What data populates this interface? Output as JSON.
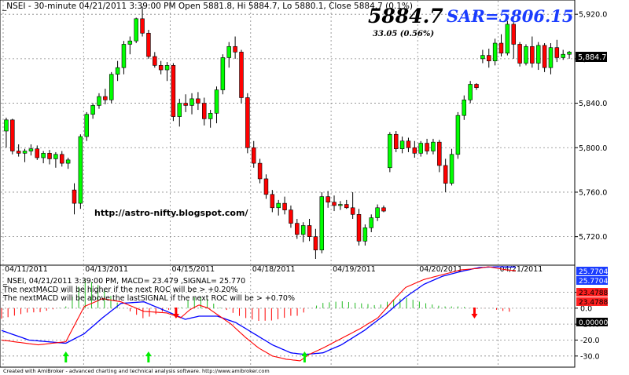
{
  "chart_data": [
    {
      "type": "candlestick",
      "header": "_NSEI - 30-minute 04/21/2011 3:39:00 PM Open 5881.8, Hi 5884.7, Lo 5880.1, Close 5884.7 (0.1%)",
      "big_price": "5884.7",
      "change_text": "33.05  (0.56%)",
      "sar_text": "SAR=5806.15",
      "watermark": "http://astro-nifty.blogspot.com/",
      "last_price_tag": "5,884.7",
      "ylim": [
        5700,
        5930
      ],
      "y_ticks": [
        5720,
        5760,
        5800,
        5840,
        5880,
        5920
      ],
      "y_tick_labels": [
        "5,720.0",
        "5,760.0",
        "5,800.0",
        "5,840.0",
        "5,880.0",
        "5,920.0"
      ],
      "x_ticks": [
        {
          "label": "04/11/2011",
          "bar": 0
        },
        {
          "label": "04/13/2011",
          "bar": 13
        },
        {
          "label": "04/15/2011",
          "bar": 27
        },
        {
          "label": "04/18/2011",
          "bar": 40
        },
        {
          "label": "04/19/2011",
          "bar": 53
        },
        {
          "label": "04/20/2011",
          "bar": 67
        },
        {
          "label": "04/21/2011",
          "bar": 80
        }
      ],
      "colors": {
        "up": "#00ff00",
        "down": "#ff0000"
      },
      "grid": true,
      "ohlc": [
        [
          5815,
          5827,
          5800,
          5825
        ],
        [
          5825,
          5826,
          5794,
          5797
        ],
        [
          5797,
          5803,
          5792,
          5795
        ],
        [
          5795,
          5799,
          5787,
          5797
        ],
        [
          5797,
          5803,
          5793,
          5799
        ],
        [
          5799,
          5802,
          5789,
          5791
        ],
        [
          5791,
          5797,
          5786,
          5795
        ],
        [
          5795,
          5798,
          5785,
          5790
        ],
        [
          5790,
          5796,
          5782,
          5794
        ],
        [
          5794,
          5797,
          5783,
          5786
        ],
        [
          5786,
          5791,
          5781,
          5789
        ],
        [
          5762,
          5768,
          5740,
          5750
        ],
        [
          5750,
          5812,
          5745,
          5810
        ],
        [
          5810,
          5832,
          5806,
          5830
        ],
        [
          5830,
          5840,
          5826,
          5838
        ],
        [
          5838,
          5849,
          5835,
          5846
        ],
        [
          5846,
          5853,
          5839,
          5843
        ],
        [
          5843,
          5868,
          5840,
          5866
        ],
        [
          5866,
          5878,
          5860,
          5872
        ],
        [
          5872,
          5896,
          5866,
          5893
        ],
        [
          5893,
          5900,
          5884,
          5896
        ],
        [
          5896,
          5917,
          5894,
          5916
        ],
        [
          5916,
          5927,
          5900,
          5903
        ],
        [
          5903,
          5906,
          5880,
          5882
        ],
        [
          5882,
          5886,
          5872,
          5874
        ],
        [
          5874,
          5878,
          5866,
          5870
        ],
        [
          5870,
          5877,
          5860,
          5874
        ],
        [
          5874,
          5876,
          5824,
          5828
        ],
        [
          5828,
          5844,
          5819,
          5840
        ],
        [
          5840,
          5848,
          5832,
          5838
        ],
        [
          5838,
          5849,
          5830,
          5844
        ],
        [
          5844,
          5850,
          5834,
          5840
        ],
        [
          5840,
          5845,
          5820,
          5826
        ],
        [
          5826,
          5834,
          5818,
          5831
        ],
        [
          5831,
          5855,
          5822,
          5852
        ],
        [
          5852,
          5884,
          5848,
          5881
        ],
        [
          5881,
          5895,
          5872,
          5891
        ],
        [
          5891,
          5900,
          5880,
          5886
        ],
        [
          5886,
          5888,
          5840,
          5845
        ],
        [
          5845,
          5849,
          5795,
          5800
        ],
        [
          5800,
          5806,
          5782,
          5786
        ],
        [
          5786,
          5790,
          5768,
          5772
        ],
        [
          5772,
          5776,
          5754,
          5758
        ],
        [
          5758,
          5762,
          5742,
          5746
        ],
        [
          5746,
          5753,
          5739,
          5750
        ],
        [
          5750,
          5756,
          5740,
          5744
        ],
        [
          5744,
          5748,
          5728,
          5732
        ],
        [
          5732,
          5736,
          5718,
          5722
        ],
        [
          5722,
          5733,
          5715,
          5730
        ],
        [
          5730,
          5736,
          5716,
          5720
        ],
        [
          5720,
          5727,
          5700,
          5708
        ],
        [
          5708,
          5760,
          5705,
          5756
        ],
        [
          5756,
          5761,
          5746,
          5751
        ],
        [
          5751,
          5757,
          5743,
          5748
        ],
        [
          5748,
          5752,
          5744,
          5749
        ],
        [
          5749,
          5753,
          5745,
          5746
        ],
        [
          5746,
          5760,
          5736,
          5740
        ],
        [
          5740,
          5745,
          5712,
          5716
        ],
        [
          5716,
          5731,
          5712,
          5728
        ],
        [
          5728,
          5740,
          5724,
          5737
        ],
        [
          5737,
          5749,
          5734,
          5746
        ],
        [
          5746,
          5748,
          5742,
          5743
        ],
        [
          5782,
          5814,
          5778,
          5812
        ],
        [
          5812,
          5815,
          5796,
          5799
        ],
        [
          5799,
          5810,
          5795,
          5806
        ],
        [
          5806,
          5809,
          5796,
          5800
        ],
        [
          5800,
          5806,
          5791,
          5795
        ],
        [
          5795,
          5806,
          5792,
          5804
        ],
        [
          5804,
          5808,
          5794,
          5797
        ],
        [
          5797,
          5808,
          5794,
          5805
        ],
        [
          5805,
          5807,
          5778,
          5784
        ],
        [
          5784,
          5790,
          5760,
          5768
        ],
        [
          5768,
          5799,
          5766,
          5794
        ],
        [
          5794,
          5832,
          5790,
          5829
        ],
        [
          5829,
          5847,
          5825,
          5843
        ],
        [
          5843,
          5860,
          5840,
          5857
        ],
        [
          5857,
          5858,
          5852,
          5854
        ],
        [
          5880,
          5888,
          5876,
          5883
        ],
        [
          5883,
          5889,
          5872,
          5878
        ],
        [
          5878,
          5898,
          5874,
          5894
        ],
        [
          5894,
          5902,
          5882,
          5885
        ],
        [
          5885,
          5914,
          5883,
          5911
        ],
        [
          5911,
          5913,
          5880,
          5893
        ],
        [
          5893,
          5895,
          5873,
          5876
        ],
        [
          5876,
          5893,
          5874,
          5891
        ],
        [
          5891,
          5900,
          5872,
          5876
        ],
        [
          5876,
          5895,
          5870,
          5892
        ],
        [
          5892,
          5894,
          5868,
          5872
        ],
        [
          5872,
          5894,
          5866,
          5890
        ],
        [
          5890,
          5897,
          5877,
          5881
        ],
        [
          5881,
          5888,
          5879,
          5884
        ],
        [
          5884,
          5887,
          5880,
          5886
        ]
      ]
    },
    {
      "type": "macd",
      "info_line": "_NSEI, 04/21/2011 3:39:00 PM, MACD= 23.479 ,SIGNAL= 25.770",
      "note_1": "The nextMACD will be higher if the next ROC will be > +0.20%",
      "note_2": "The nextMACD will be above the lastSIGNAL if the next ROC will be > +0.70%",
      "footer": "Created with AmiBroker - advanced charting and technical analysis software. http://www.amibroker.com",
      "ylim": [
        -36,
        26
      ],
      "y_ticks": [
        10,
        0,
        -10,
        -20,
        -30
      ],
      "y_tick_labels": [
        "10.0",
        "0.0",
        "-10.0",
        "-20.0",
        "-30.0"
      ],
      "signal_tags": [
        "25.7704",
        "25.7704"
      ],
      "macd_tags": [
        "23.4788",
        "23.4788"
      ],
      "zero_tag": "0.00000",
      "macd_color": "#ff0000",
      "signal_color": "#0000ff",
      "histogram_pos_color": "#22bb22",
      "histogram_neg_color": "#ff0000",
      "macd_points": [
        [
          0,
          -20
        ],
        [
          8,
          -23
        ],
        [
          14,
          -21
        ],
        [
          18,
          1
        ],
        [
          22,
          6
        ],
        [
          26,
          4
        ],
        [
          31,
          -2
        ],
        [
          36,
          -3
        ],
        [
          39,
          -6
        ],
        [
          41,
          -1
        ],
        [
          43,
          2
        ],
        [
          45,
          0
        ],
        [
          47,
          -4
        ],
        [
          50,
          -10
        ],
        [
          53,
          -18
        ],
        [
          56,
          -25
        ],
        [
          59,
          -30
        ],
        [
          62,
          -32
        ],
        [
          65,
          -33
        ],
        [
          67,
          -29
        ],
        [
          70,
          -25
        ],
        [
          74,
          -19
        ],
        [
          78,
          -13
        ],
        [
          82,
          -6
        ],
        [
          85,
          4
        ],
        [
          88,
          13
        ],
        [
          92,
          18
        ],
        [
          96,
          21
        ],
        [
          100,
          24
        ],
        [
          104,
          25
        ],
        [
          106,
          26
        ],
        [
          108,
          25
        ],
        [
          110,
          24
        ],
        [
          112,
          23.5
        ]
      ],
      "signal_points": [
        [
          0,
          -14
        ],
        [
          6,
          -20
        ],
        [
          14,
          -22
        ],
        [
          18,
          -16
        ],
        [
          22,
          -6
        ],
        [
          26,
          3
        ],
        [
          31,
          4
        ],
        [
          36,
          -2
        ],
        [
          40,
          -7
        ],
        [
          43,
          -5
        ],
        [
          47,
          -5
        ],
        [
          51,
          -9
        ],
        [
          55,
          -16
        ],
        [
          59,
          -23
        ],
        [
          63,
          -28
        ],
        [
          66,
          -29
        ],
        [
          70,
          -28
        ],
        [
          74,
          -23
        ],
        [
          79,
          -14
        ],
        [
          84,
          -3
        ],
        [
          88,
          7
        ],
        [
          92,
          15
        ],
        [
          96,
          20
        ],
        [
          100,
          23
        ],
        [
          104,
          25.5
        ],
        [
          108,
          26
        ],
        [
          112,
          25.8
        ]
      ],
      "arrows": [
        {
          "x": 14,
          "dir": "up",
          "color": "#00ee00"
        },
        {
          "x": 32,
          "dir": "up",
          "color": "#00ee00"
        },
        {
          "x": 38,
          "dir": "down",
          "color": "#ff0000"
        },
        {
          "x": 66,
          "dir": "up",
          "color": "#00ee00"
        },
        {
          "x": 103,
          "dir": "down",
          "color": "#ff0000"
        }
      ],
      "grid": true
    }
  ]
}
